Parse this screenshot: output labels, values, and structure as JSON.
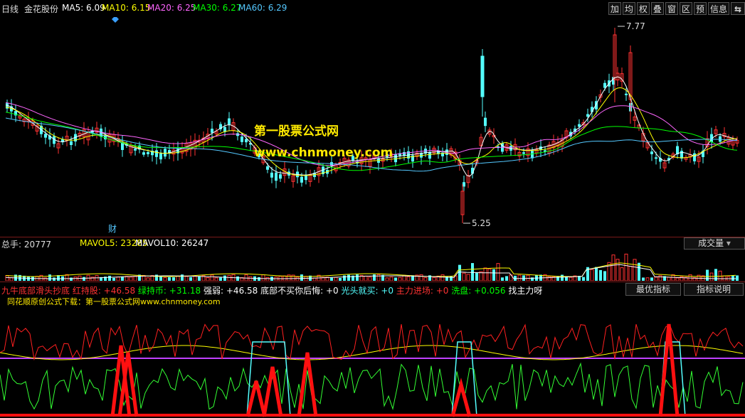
{
  "colors": {
    "bg": "#000000",
    "up": "#ff3232",
    "down": "#54ffff",
    "ma5": "#ffffff",
    "ma10": "#ffff00",
    "ma20": "#ff66ff",
    "ma30": "#00ff00",
    "ma60": "#54c8ff"
  },
  "header": {
    "period": "日线",
    "stock": "金花股份",
    "ma5": "MA5: 6.09",
    "ma10": "MA10: 6.15",
    "ma20": "MA20: 6.25",
    "ma30": "MA30: 6.27",
    "ma60": "MA60: 6.29",
    "toolbar": [
      "加",
      "均",
      "权",
      "叠",
      "窗",
      "区",
      "预",
      "信息",
      "⇆"
    ]
  },
  "watermark": {
    "site": "第一股票公式网",
    "url": "www.chnmoney.com"
  },
  "price": {
    "high_label": "7.77",
    "low_label": "5.25",
    "marker": "财"
  },
  "volume": {
    "total": "总手: 20777",
    "mavol5": "MAVOL5: 23285",
    "mavol10": "MAVOL10: 26247",
    "type_button": "成交量"
  },
  "indicator": {
    "items": [
      {
        "text": "九牛底部滑头抄底",
        "color": "#ff3232"
      },
      {
        "text": "红持股: +46.58",
        "color": "#ff3232"
      },
      {
        "text": "绿持币: +31.18",
        "color": "#00ff00"
      },
      {
        "text": "强弱: +46.58",
        "color": "#ffffff"
      },
      {
        "text": "底部不买你后悔: +0",
        "color": "#ffffff"
      },
      {
        "text": "光头就买: +0",
        "color": "#54ffff"
      },
      {
        "text": "主力进场: +0",
        "color": "#ff3232"
      },
      {
        "text": "洗盘: +0.056",
        "color": "#00ff00"
      },
      {
        "text": "找主力呀",
        "color": "#ffffff"
      }
    ],
    "best_button": "最优指标",
    "help_button": "指标说明",
    "credit": "同花顺原创公式下载：第一股票公式网www.chnmoney.com"
  }
}
